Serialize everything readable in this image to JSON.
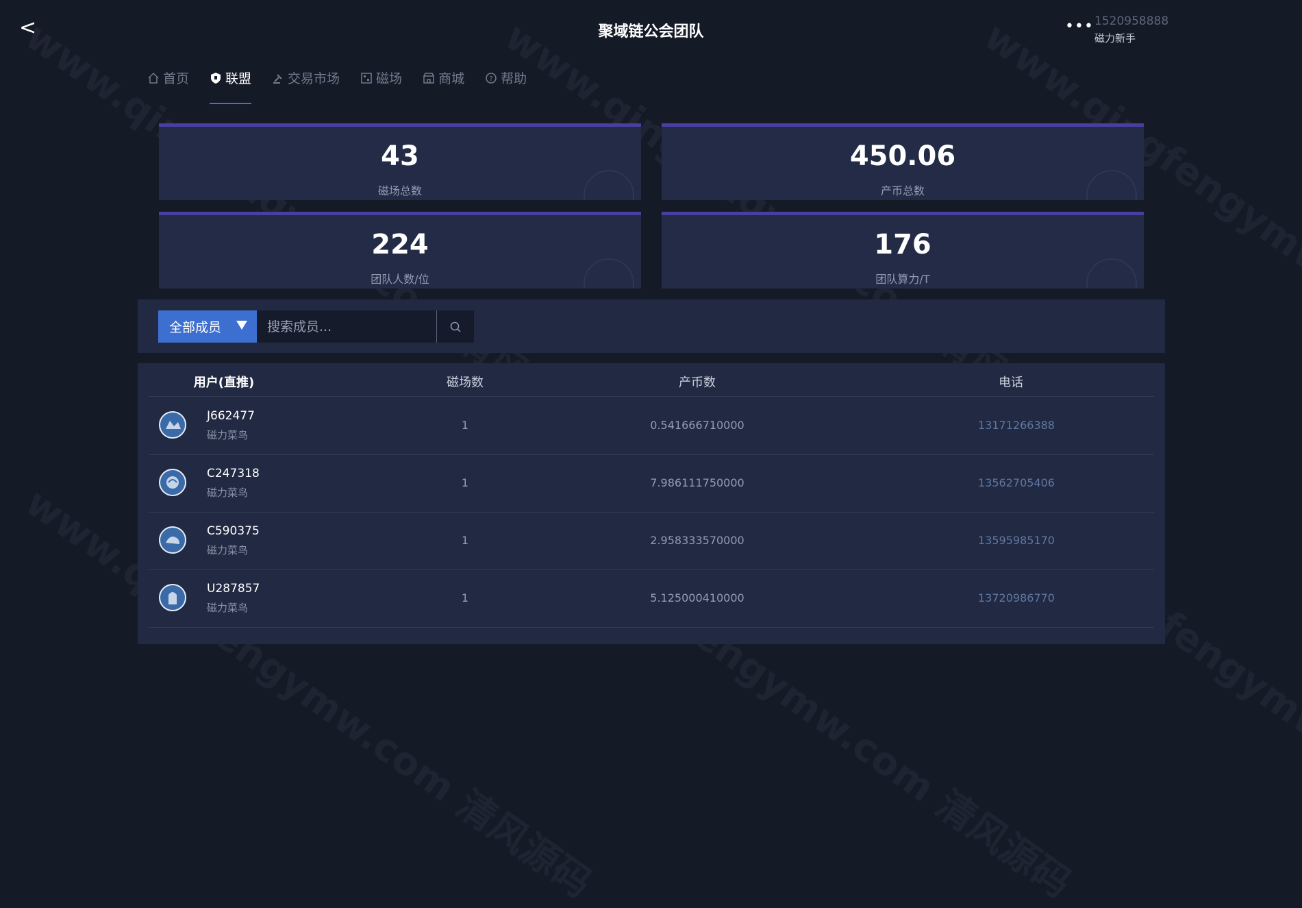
{
  "header": {
    "back_label": "<",
    "title": "聚域链公会团队",
    "more_label": "•••",
    "user_phone": "1520958888",
    "user_level": "磁力新手"
  },
  "nav": {
    "items": [
      {
        "label": "首页",
        "icon": "home-icon",
        "active": false
      },
      {
        "label": "联盟",
        "icon": "shield-icon",
        "active": true
      },
      {
        "label": "交易市场",
        "icon": "gavel-icon",
        "active": false
      },
      {
        "label": "磁场",
        "icon": "grid-icon",
        "active": false
      },
      {
        "label": "商城",
        "icon": "store-icon",
        "active": false
      },
      {
        "label": "帮助",
        "icon": "help-icon",
        "active": false
      }
    ]
  },
  "stats": [
    {
      "value": "43",
      "label": "磁场总数"
    },
    {
      "value": "450.06",
      "label": "产币总数"
    },
    {
      "value": "224",
      "label": "团队人数/位"
    },
    {
      "value": "176",
      "label": "团队算力/T"
    }
  ],
  "filter": {
    "select_label": "全部成员",
    "search_placeholder": "搜索成员..."
  },
  "table": {
    "headers": [
      "用户(直推)",
      "磁场数",
      "产币数",
      "电话"
    ],
    "rows": [
      {
        "user": "J662477",
        "role": "磁力菜鸟",
        "magnet": "1",
        "coins": "0.541666710000",
        "phone": "13171266388"
      },
      {
        "user": "C247318",
        "role": "磁力菜鸟",
        "magnet": "1",
        "coins": "7.986111750000",
        "phone": "13562705406"
      },
      {
        "user": "C590375",
        "role": "磁力菜鸟",
        "magnet": "1",
        "coins": "2.958333570000",
        "phone": "13595985170"
      },
      {
        "user": "U287857",
        "role": "磁力菜鸟",
        "magnet": "1",
        "coins": "5.125000410000",
        "phone": "13720986770"
      }
    ]
  },
  "watermark": "www.qingfengymw.com 清风源码",
  "colors": {
    "accent": "#3d6fd0",
    "background": "#151a27",
    "card": "#232b46"
  }
}
